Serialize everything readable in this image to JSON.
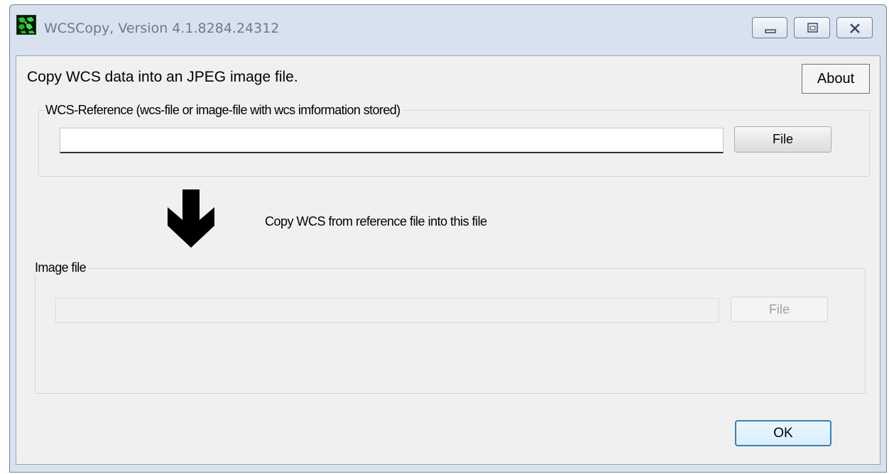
{
  "window": {
    "title": "WCSCopy, Version 4.1.8284.24312",
    "app_icon": "wcscopy-app-icon",
    "caption_buttons": [
      "minimize",
      "maximize",
      "close"
    ]
  },
  "main": {
    "heading": "Copy WCS data into an JPEG image file.",
    "about_label": "About",
    "reference_group": {
      "label": "WCS-Reference (wcs-file or image-file with wcs imformation stored)",
      "path_value": "",
      "file_button_label": "File"
    },
    "copy_note": "Copy WCS from reference file into this file",
    "arrow_icon": "down-arrow-icon",
    "image_group": {
      "label": "Image file",
      "path_value": "",
      "file_button_label": "File",
      "enabled": false
    },
    "ok_label": "OK"
  },
  "colors": {
    "window_frame": "#d8e1ee",
    "client_bg": "#f0f0f0",
    "ok_border": "#3c7fb1",
    "disabled_text": "#a0a0a0"
  }
}
